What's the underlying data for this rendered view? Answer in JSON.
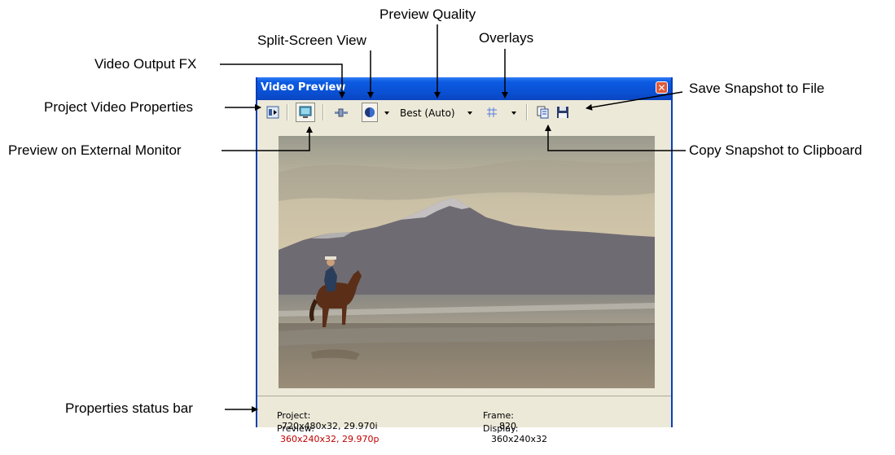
{
  "window": {
    "title": "Video Preview",
    "close_symbol": "✕"
  },
  "toolbar": {
    "project_video_properties_icon": "project-properties-icon",
    "external_monitor_icon": "monitor-icon",
    "video_output_fx_icon": "fx-plug-icon",
    "split_screen_icon": "split-screen-icon",
    "preview_quality": "Best (Auto)",
    "overlays_icon": "grid-icon",
    "copy_snapshot_icon": "copy-icon",
    "save_snapshot_icon": "floppy-disk-icon"
  },
  "status": {
    "project_label": "Project:",
    "project_value": "720x480x32, 29.970i",
    "preview_label": "Preview:",
    "preview_value": "360x240x32, 29.970p",
    "frame_label": "Frame:",
    "frame_value": "820",
    "display_label": "Display:",
    "display_value": "360x240x32"
  },
  "callouts": {
    "preview_quality": "Preview Quality",
    "split_screen_view": "Split-Screen View",
    "overlays": "Overlays",
    "video_output_fx": "Video Output FX",
    "save_snapshot": "Save Snapshot to File",
    "project_video_properties": "Project Video Properties",
    "preview_external_monitor": "Preview on External Monitor",
    "copy_snapshot": "Copy Snapshot to Clipboard",
    "properties_status_bar": "Properties status bar"
  },
  "colors": {
    "titlebar": "#0a4fd2",
    "window_bg": "#ece9d8",
    "preview_value_color": "#c00000"
  }
}
